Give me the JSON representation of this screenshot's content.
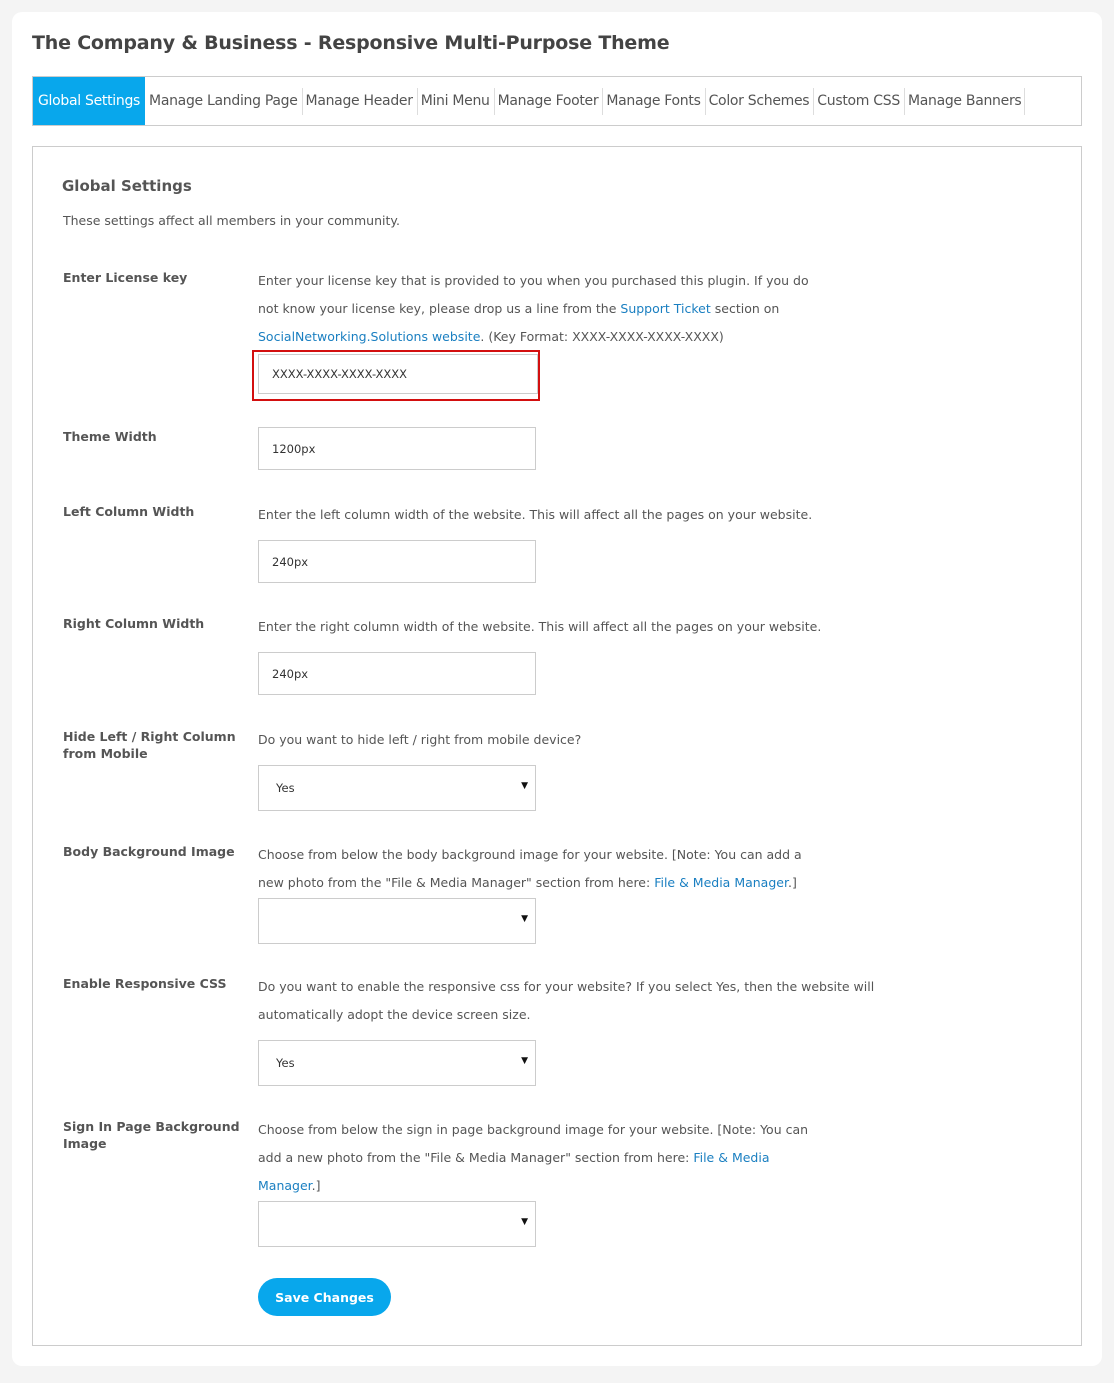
{
  "page_title": "The Company & Business - Responsive Multi-Purpose Theme",
  "tabs": [
    {
      "label": "Global Settings",
      "active": true
    },
    {
      "label": "Manage Landing Page"
    },
    {
      "label": "Manage Header"
    },
    {
      "label": "Mini Menu"
    },
    {
      "label": "Manage Footer"
    },
    {
      "label": "Manage Fonts"
    },
    {
      "label": "Color Schemes"
    },
    {
      "label": "Custom CSS"
    },
    {
      "label": "Manage Banners"
    }
  ],
  "panel": {
    "title": "Global Settings",
    "description": "These settings affect all members in your community."
  },
  "colors": {
    "accent": "#08a7ec",
    "link": "#1a7fc1",
    "highlight": "#d30f0f"
  },
  "fields": {
    "license": {
      "label": "Enter License key",
      "desc_1": "Enter your license key that is provided to you when you purchased this plugin. If you do",
      "desc_2a": "not know your license key, please drop us a line from the ",
      "desc_2_link": "Support Ticket",
      "desc_2b": " section on",
      "desc_3_link": "SocialNetworking.Solutions website",
      "desc_3b": ". (Key Format: XXXX-XXXX-XXXX-XXXX)",
      "value": "XXXX-XXXX-XXXX-XXXX"
    },
    "theme_width": {
      "label": "Theme Width",
      "value": "1200px"
    },
    "left_column_width": {
      "label": "Left Column Width",
      "desc": "Enter the left column width of the website. This will affect all the pages on your website.",
      "value": "240px"
    },
    "right_column_width": {
      "label": "Right Column Width",
      "desc": "Enter the right column width of the website. This will affect all the pages on your website.",
      "value": "240px"
    },
    "hide_columns_mobile": {
      "label_1": "Hide Left / Right Column",
      "label_2": "from Mobile",
      "desc": "Do you want to hide left / right from mobile device?",
      "selected": "Yes"
    },
    "body_background": {
      "label": "Body Background Image",
      "desc_1": "Choose from below the body background image for your website. [Note: You can add a",
      "desc_2a": "new photo from the \"File & Media Manager\" section from here: ",
      "desc_2_link": "File & Media Manager",
      "desc_2b": ".]",
      "selected": ""
    },
    "responsive_css": {
      "label": "Enable Responsive CSS",
      "desc_1": "Do you want to enable the responsive css for your website? If you select Yes, then the website will",
      "desc_2": "automatically adopt the device screen size.",
      "selected": "Yes"
    },
    "signin_background": {
      "label_1": "Sign In Page Background",
      "label_2": "Image",
      "desc_1": "Choose from below the sign in page background image for your website. [Note: You can",
      "desc_2a": "add a new photo from the \"File & Media Manager\" section from here: ",
      "desc_2_link": "File & Media",
      "desc_3_link": "Manager",
      "desc_3b": ".]",
      "selected": ""
    }
  },
  "save_label": "Save Changes",
  "icons": {
    "dropdown": "▼"
  }
}
